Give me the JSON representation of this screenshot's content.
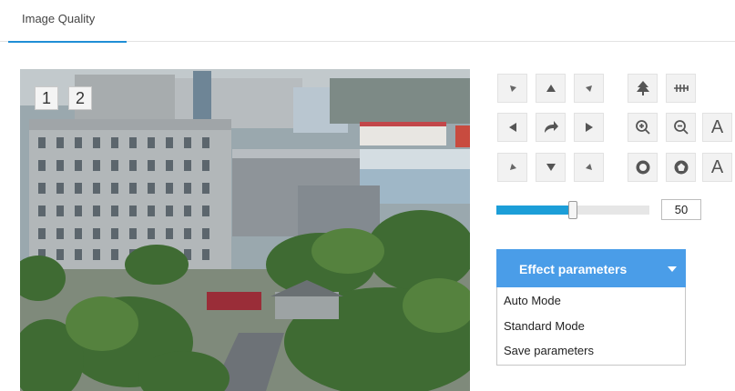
{
  "tab": {
    "label": "Image Quality"
  },
  "preview": {
    "channels": [
      "1",
      "2"
    ]
  },
  "ptz": {
    "zoom_in_label": "A",
    "zoom_out_label": "A"
  },
  "slider": {
    "value": "50",
    "level": 0.5
  },
  "effect_menu": {
    "title": "Effect parameters",
    "items": [
      "Auto Mode",
      "Standard Mode",
      "Save parameters"
    ]
  },
  "colors": {
    "accent": "#1f8ed6",
    "slider_fill": "#1c9ed8",
    "dropdown": "#4a9de8"
  }
}
